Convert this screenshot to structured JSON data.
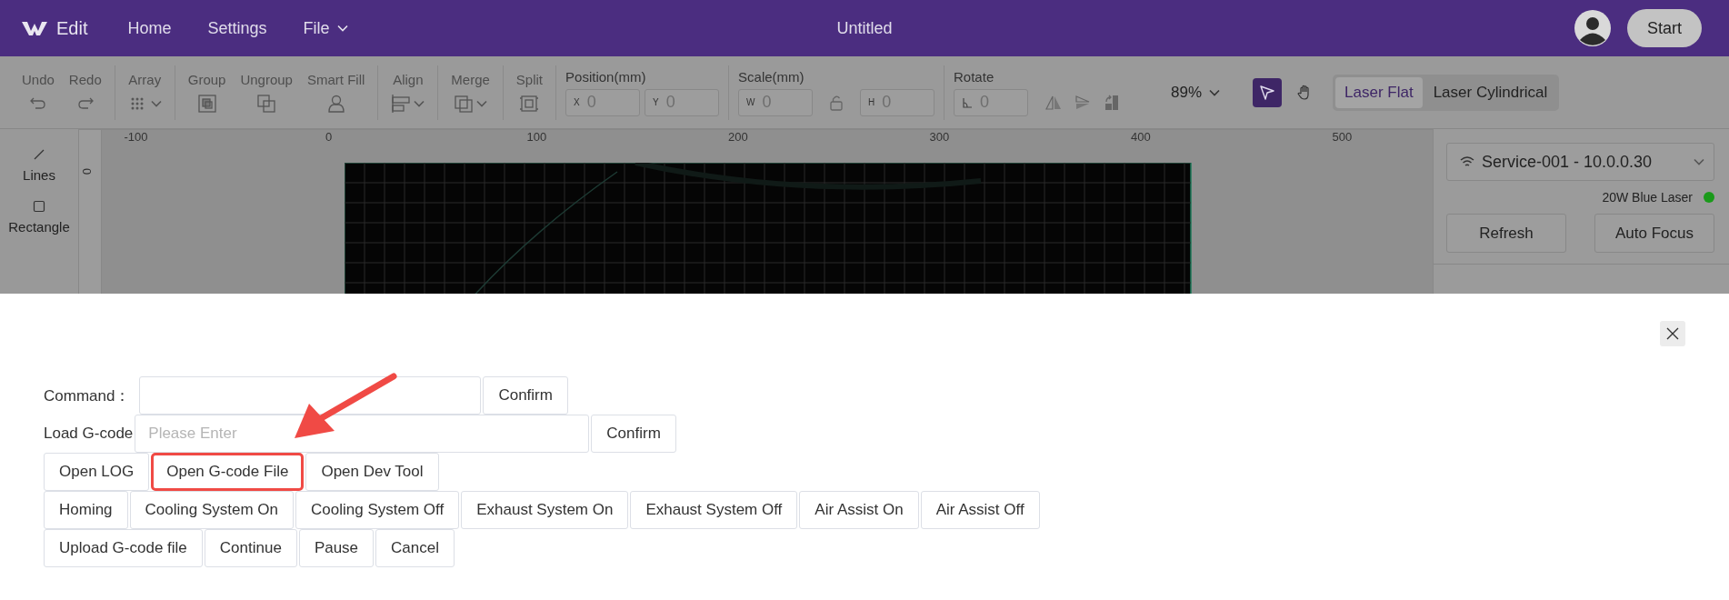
{
  "header": {
    "app_name": "Edit",
    "menu": [
      {
        "label": "Home",
        "kind": "link"
      },
      {
        "label": "Settings",
        "kind": "link"
      },
      {
        "label": "File",
        "kind": "dropdown"
      }
    ],
    "title": "Untitled",
    "start_button": "Start"
  },
  "toolbar": {
    "groups": [
      {
        "tools": [
          {
            "label": "Undo",
            "dropdown": false
          },
          {
            "label": "Redo",
            "dropdown": false
          }
        ]
      },
      {
        "tools": [
          {
            "label": "Array",
            "dropdown": true
          }
        ]
      },
      {
        "tools": [
          {
            "label": "Group",
            "dropdown": false
          },
          {
            "label": "Ungroup",
            "dropdown": false
          },
          {
            "label": "Smart Fill",
            "dropdown": false
          }
        ]
      },
      {
        "tools": [
          {
            "label": "Align",
            "dropdown": true
          }
        ]
      },
      {
        "tools": [
          {
            "label": "Merge",
            "dropdown": true
          }
        ]
      },
      {
        "tools": [
          {
            "label": "Split",
            "dropdown": false
          }
        ]
      }
    ],
    "position": {
      "label": "Position(mm)",
      "fields": [
        {
          "prefix": "X",
          "placeholder": "0"
        },
        {
          "prefix": "Y",
          "placeholder": "0"
        }
      ]
    },
    "scale": {
      "label": "Scale(mm)",
      "fields": [
        {
          "prefix": "W",
          "placeholder": "0"
        },
        {
          "prefix": "H",
          "placeholder": "0"
        }
      ],
      "locked": false
    },
    "rotate": {
      "label": "Rotate",
      "placeholder": "0"
    },
    "zoom": "89%",
    "pointer_modes": [
      {
        "selected": true
      },
      {
        "selected": false
      }
    ],
    "laser_modes": [
      {
        "label": "Laser Flat",
        "selected": true
      },
      {
        "label": "Laser Cylindrical",
        "selected": false
      }
    ]
  },
  "left_tools": [
    {
      "label": "Lines"
    },
    {
      "label": "Rectangle"
    }
  ],
  "ruler": {
    "x_labels": [
      "-100",
      "0",
      "100",
      "200",
      "300",
      "400",
      "500"
    ],
    "y_labels": [
      "0"
    ]
  },
  "device_panel": {
    "device": "Service-001 - 10.0.0.30",
    "laser": {
      "label": "20W Blue Laser",
      "color": "#1a9a1a"
    },
    "buttons": [
      "Refresh",
      "Auto Focus"
    ]
  },
  "dialog": {
    "fields": [
      {
        "label": "Command：",
        "button": "Confirm"
      },
      {
        "label": "Load G-code",
        "placeholder": "Please Enter",
        "button": "Confirm"
      }
    ],
    "button_rows": [
      [
        {
          "label": "Open LOG",
          "highlighted": false
        },
        {
          "label": "Open G-code File",
          "highlighted": true
        },
        {
          "label": "Open Dev Tool",
          "highlighted": false
        }
      ],
      [
        {
          "label": "Homing",
          "highlighted": false
        },
        {
          "label": "Cooling System On",
          "highlighted": false
        },
        {
          "label": "Cooling System Off",
          "highlighted": false
        },
        {
          "label": "Exhaust System On",
          "highlighted": false
        },
        {
          "label": "Exhaust System Off",
          "highlighted": false
        },
        {
          "label": "Air Assist On",
          "highlighted": false
        },
        {
          "label": "Air Assist Off",
          "highlighted": false
        }
      ],
      [
        {
          "label": "Upload G-code file",
          "highlighted": false
        },
        {
          "label": "Continue",
          "highlighted": false
        },
        {
          "label": "Pause",
          "highlighted": false
        },
        {
          "label": "Cancel",
          "highlighted": false
        }
      ]
    ]
  }
}
